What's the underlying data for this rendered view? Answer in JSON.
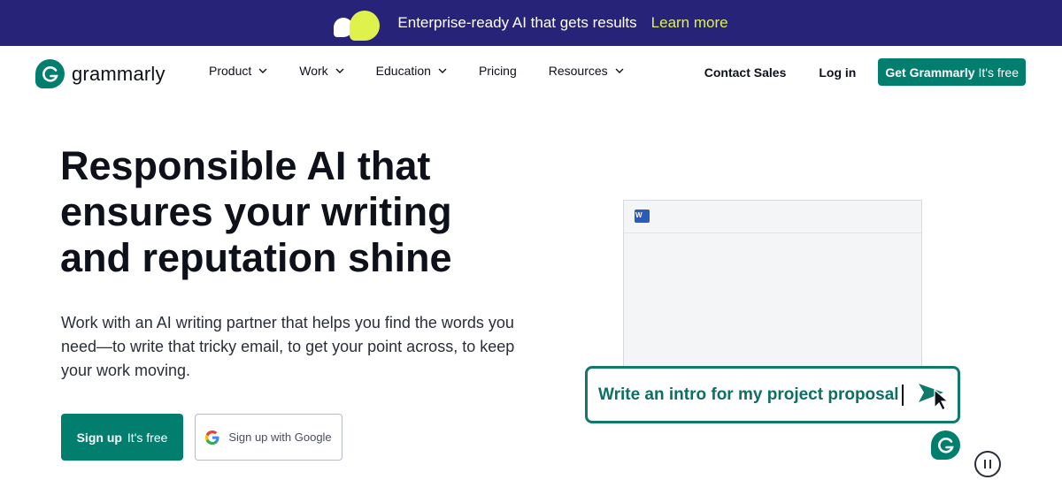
{
  "banner": {
    "text": "Enterprise-ready AI that gets results",
    "link": "Learn more",
    "colors": {
      "background": "#272378",
      "accent": "#dff24c"
    }
  },
  "nav": {
    "brand": "grammarly",
    "items": [
      {
        "label": "Product",
        "has_dropdown": true
      },
      {
        "label": "Work",
        "has_dropdown": true
      },
      {
        "label": "Education",
        "has_dropdown": true
      },
      {
        "label": "Pricing",
        "has_dropdown": false
      },
      {
        "label": "Resources",
        "has_dropdown": true
      }
    ],
    "contact_sales": "Contact Sales",
    "login": "Log in",
    "cta_bold": "Get Grammarly",
    "cta_light": "It's free"
  },
  "hero": {
    "title_lines": [
      "Responsible AI that",
      "ensures your writing",
      "and reputation shine"
    ],
    "subtitle": "Work with an AI writing partner that helps you find the words you need—to write that tricky email, to get your point across, to keep your work moving.",
    "signup_bold": "Sign up",
    "signup_light": "It's free",
    "google_button": "Sign up with Google"
  },
  "illustration": {
    "app_icon": "word-icon",
    "word_letter": "W",
    "prompt": "Write an intro for my project proposal"
  },
  "icons": [
    "chevron-down-icon",
    "google-icon",
    "send-icon",
    "mouse-pointer-icon",
    "grammarly-g-icon",
    "pause-icon"
  ],
  "colors": {
    "brand": "#027e6f",
    "text": "#0e101a"
  }
}
